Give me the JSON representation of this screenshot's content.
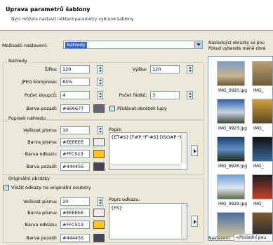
{
  "header": {
    "title": "Úprava parametrů šablony",
    "subtitle": "Nyní můžete nastavit některé parametry vybrané šablony."
  },
  "settings": {
    "label": "Možnosti nastavení:",
    "value": "Náhledy"
  },
  "nahledy": {
    "group_title": "Náhledy",
    "sirka_label": "Šířka:",
    "sirka_value": "120",
    "vyska_label": "Výška:",
    "vyska_value": "120",
    "jpeg_label": "JPEG komprese:",
    "jpeg_value": "85%",
    "sloupcu_label": "Počet sloupců:",
    "sloupcu_value": "4",
    "radku_label": "Počet řádků:",
    "radku_value": "3",
    "pozadi_label": "Barva pozadí:",
    "pozadi_value": "#666677",
    "pozadi_color": "#666677",
    "lupa_label": "Přidávat obrázek lupy",
    "lupa_checked": true
  },
  "popisek": {
    "group_title": "Popisek náhledu",
    "velikost_label": "Velikost písma:",
    "velikost_value": "10",
    "pismo_label": "Barva písma:",
    "pismo_value": "#EEEEEE",
    "pismo_color": "#EEEEEE",
    "odkazu_label": "Barva odkazu:",
    "odkazu_value": "#FFC513",
    "odkazu_color": "#FFC513",
    "pozadi_label": "Barva pozadí:",
    "pozadi_value": "#444455",
    "pozadi_color": "#444455",
    "popis_label": "Popis:",
    "popis_value": "{ET#S}{F#P:\"F\"#S}{ISO#P:\"IS"
  },
  "original": {
    "group_title": "Originální obrázky",
    "vlozit_label": "Vložit odkazy na originální soubory",
    "vlozit_checked": true,
    "velikost_label": "Velikost písma:",
    "velikost_value": "10",
    "pismo_label": "Barva písma:",
    "pismo_value": "#EEEEEE",
    "pismo_color": "#EEEEEE",
    "odkazu_label": "Barva odkazu:",
    "odkazu_value": "#FFC513",
    "odkazu_color": "#FFC513",
    "pozadi_label": "Barva pozadí:",
    "pozadi_value": "#444455",
    "pozadi_color": "#444455",
    "popis_label": "Popis odkazu:",
    "popis_value": "{FS}"
  },
  "preview": {
    "info_line1": "Následující obrázky se pou",
    "info_line2": "Pokud vyberete méně obrá",
    "thumbs": [
      "IMG_0920.jpg",
      "IMG_",
      "IMG_0923.jpg",
      "IMG_",
      "IMG_0926.jpg",
      "IMG_",
      "IMG_0929.jpg",
      "IMG_"
    ],
    "nastaveni_label": "Nastavení:",
    "nastaveni_value": "<Poslední pou"
  }
}
